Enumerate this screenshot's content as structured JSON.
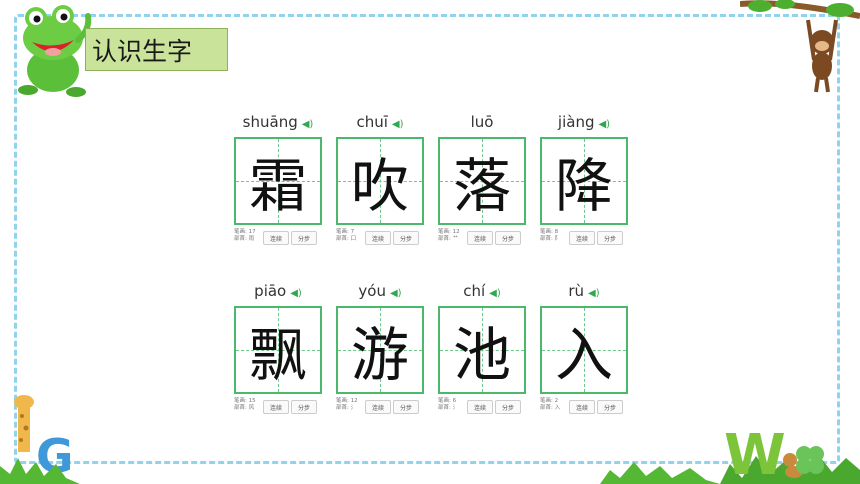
{
  "title": "认识生字",
  "characters_top": [
    {
      "pinyin": "shuāng",
      "hanzi": "霜",
      "strokes": "笔画: 17",
      "radical": "部首: 雨"
    },
    {
      "pinyin": "chuī",
      "hanzi": "吹",
      "strokes": "笔画: 7",
      "radical": "部首: 口"
    },
    {
      "pinyin": "luō",
      "hanzi": "落",
      "strokes": "笔画: 12",
      "radical": "部首: 艹"
    },
    {
      "pinyin": "jiàng",
      "hanzi": "降",
      "strokes": "笔画: 8",
      "radical": "部首: 阝"
    }
  ],
  "characters_bottom": [
    {
      "pinyin": "piāo",
      "hanzi": "飘",
      "strokes": "笔画: 15",
      "radical": "部首: 风"
    },
    {
      "pinyin": "yóu",
      "hanzi": "游",
      "strokes": "笔画: 12",
      "radical": "部首: 氵"
    },
    {
      "pinyin": "chí",
      "hanzi": "池",
      "strokes": "笔画: 6",
      "radical": "部首: 氵"
    },
    {
      "pinyin": "rù",
      "hanzi": "入",
      "strokes": "笔画: 2",
      "radical": "部首: 入"
    }
  ],
  "buttons": {
    "continuous": "连续",
    "step": "分步"
  },
  "icons": {
    "speaker": "speaker-icon"
  },
  "colors": {
    "frame": "#8fd3ef",
    "grid": "#4bb86b",
    "title_bg": "#c9e39b"
  }
}
